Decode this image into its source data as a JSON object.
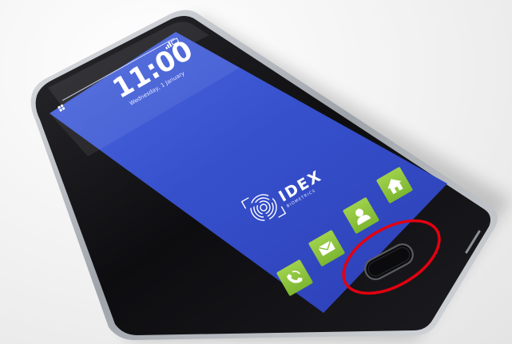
{
  "lock_screen": {
    "time": "11:00",
    "date": "Wednesday, 1 January"
  },
  "brand": {
    "name": "IDEX",
    "tagline": "BIOMETRICS"
  },
  "dock": {
    "items": [
      {
        "icon": "phone-icon"
      },
      {
        "icon": "envelope-icon"
      },
      {
        "icon": "contact-icon"
      },
      {
        "icon": "home-icon"
      }
    ],
    "tile_color": "#8dc63f"
  },
  "highlight": {
    "target": "home-button",
    "color": "#e3000f"
  },
  "colors": {
    "screen_top": "#3f5fd8",
    "screen_bottom": "#2a40b8",
    "phone_body": "#111111",
    "frame_silver": "#bfc3c8"
  }
}
